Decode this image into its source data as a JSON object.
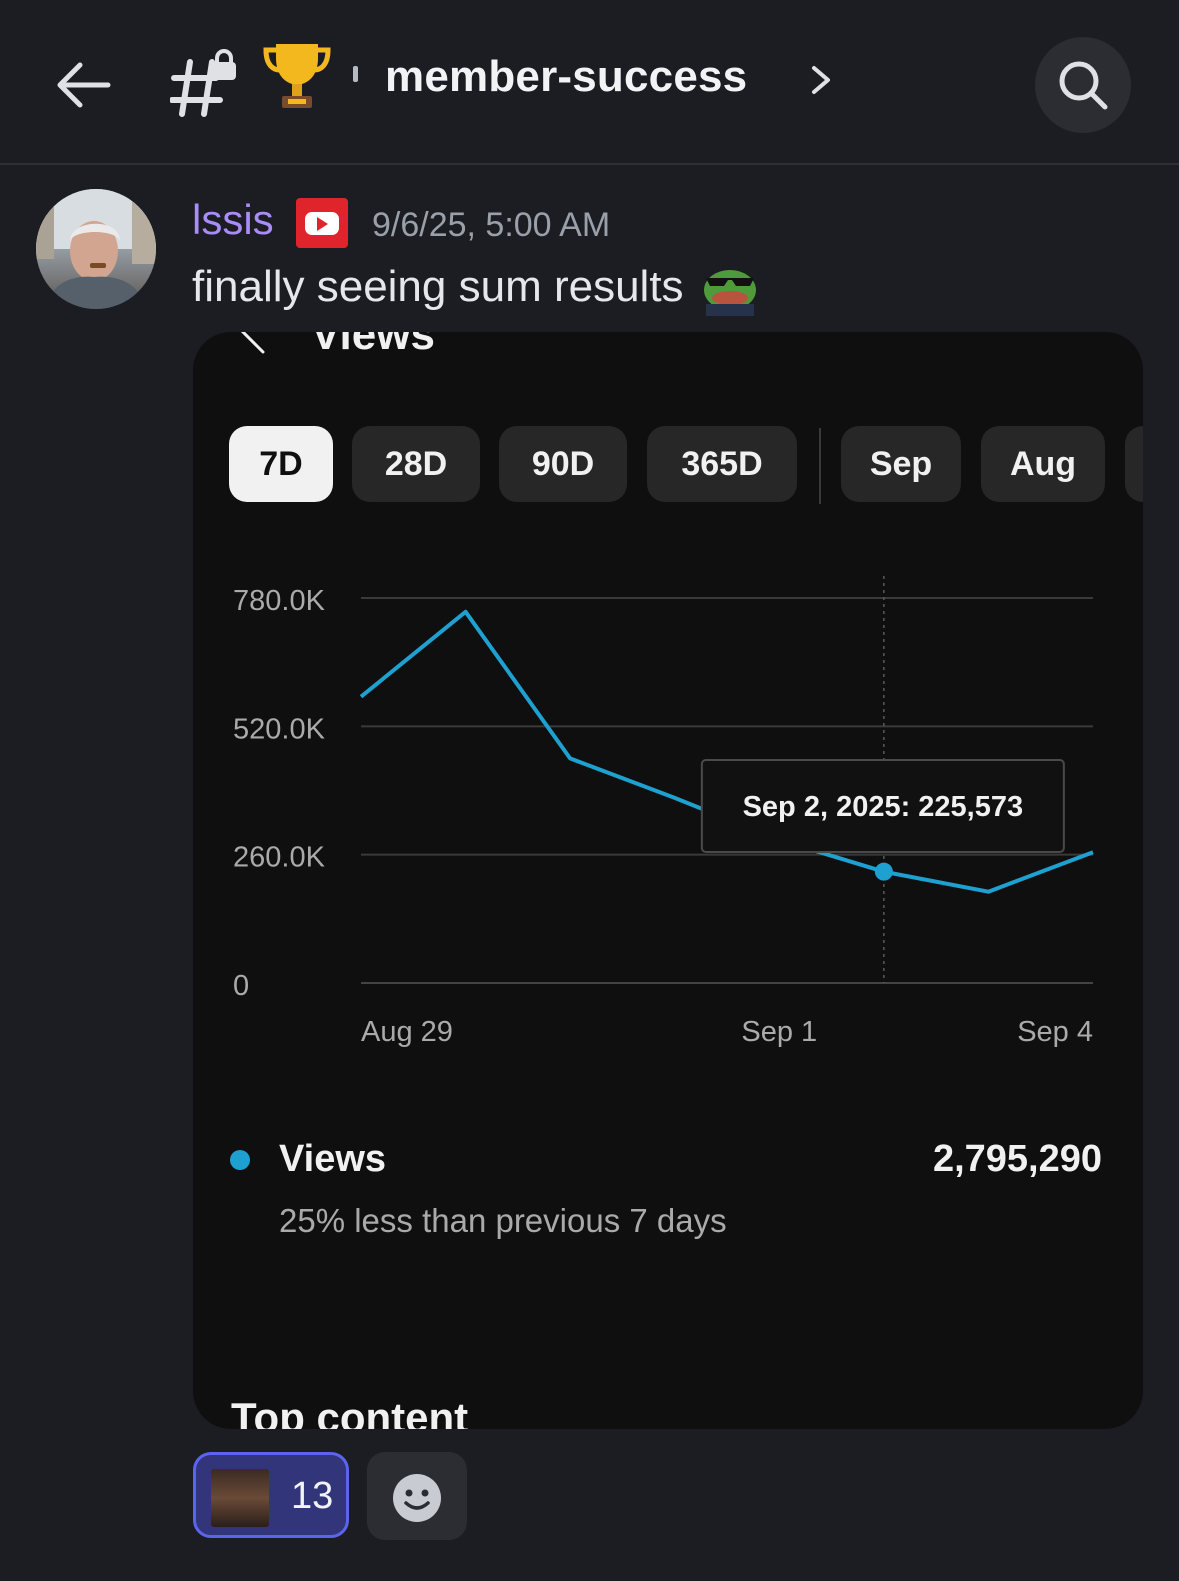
{
  "header": {
    "channel_emoji": "🏆",
    "channel_name": "member-success"
  },
  "message": {
    "author": "lssis",
    "timestamp": "9/6/25, 5:00 AM",
    "text": "finally seeing sum results"
  },
  "card": {
    "title": "Views",
    "chips": [
      "7D",
      "28D",
      "90D",
      "365D",
      "Sep",
      "Aug"
    ],
    "active_chip": "7D",
    "legend": {
      "name": "Views",
      "value": "2,795,290",
      "subtext": "25% less than previous 7 days"
    },
    "next_section": "Top content"
  },
  "chart_data": {
    "type": "line",
    "y_ticks": [
      "780.0K",
      "520.0K",
      "260.0K",
      "0"
    ],
    "x_tick_labels": [
      "Aug 29",
      "Sep 1",
      "Sep 4"
    ],
    "ylim": [
      0,
      780000
    ],
    "grid": true,
    "series": [
      {
        "color": "#1ea1d1",
        "points": [
          {
            "x": "Aug 28",
            "y": 580000
          },
          {
            "x": "Aug 29",
            "y": 752000
          },
          {
            "x": "Aug 30",
            "y": 455000
          },
          {
            "x": "Aug 31",
            "y": 375000
          },
          {
            "x": "Sep 1",
            "y": 290000
          },
          {
            "x": "Sep 2",
            "y": 225573
          },
          {
            "x": "Sep 3",
            "y": 185000
          },
          {
            "x": "Sep 4",
            "y": 265000
          }
        ]
      }
    ],
    "tooltip": {
      "text": "Sep 2, 2025: 225,573",
      "point": "Sep 2"
    }
  },
  "reactions": [
    {
      "count": "13"
    }
  ],
  "colors": {
    "accent_line": "#1ea1d1",
    "username": "#a98cf8",
    "background": "#1c1d22",
    "card_background": "#0f0f10"
  }
}
